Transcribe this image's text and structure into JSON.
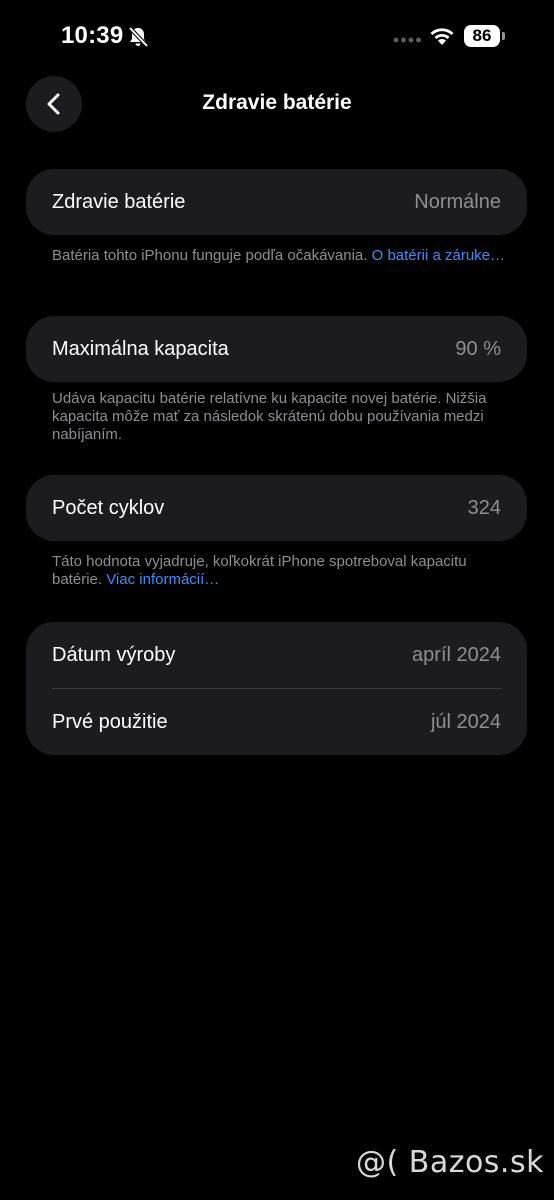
{
  "status_bar": {
    "time": "10:39",
    "battery_level": "86"
  },
  "nav": {
    "title": "Zdravie batérie"
  },
  "health_card": {
    "label": "Zdravie batérie",
    "value": "Normálne"
  },
  "health_note": {
    "text": "Batéria tohto iPhonu funguje podľa očakávania. ",
    "link": "O batérii a záruke…"
  },
  "capacity_card": {
    "label": "Maximálna kapacita",
    "value": "90 %"
  },
  "capacity_note": {
    "text": "Udáva kapacitu batérie relatívne ku kapacite novej batérie. Nižšia kapacita môže mať za následok skrátenú dobu používania medzi nabíjaním."
  },
  "cycles_card": {
    "label": "Počet cyklov",
    "value": "324"
  },
  "cycles_note": {
    "text": "Táto hodnota vyjadruje, koľkokrát iPhone spotreboval kapacitu batérie. ",
    "link": "Viac informácií…"
  },
  "dates_card": {
    "rows": [
      {
        "label": "Dátum výroby",
        "value": "apríl 2024"
      },
      {
        "label": "Prvé použitie",
        "value": "júl 2024"
      }
    ]
  },
  "watermark": {
    "text": "@( Bazos.sk"
  },
  "colors": {
    "background": "#000000",
    "card": "#1c1c1e",
    "secondary_text": "#8e8e93",
    "link": "#3a8dff"
  },
  "icons": [
    "mute-bell-icon",
    "signal-dots-icon",
    "wifi-icon",
    "battery-icon",
    "chevron-left-icon"
  ]
}
